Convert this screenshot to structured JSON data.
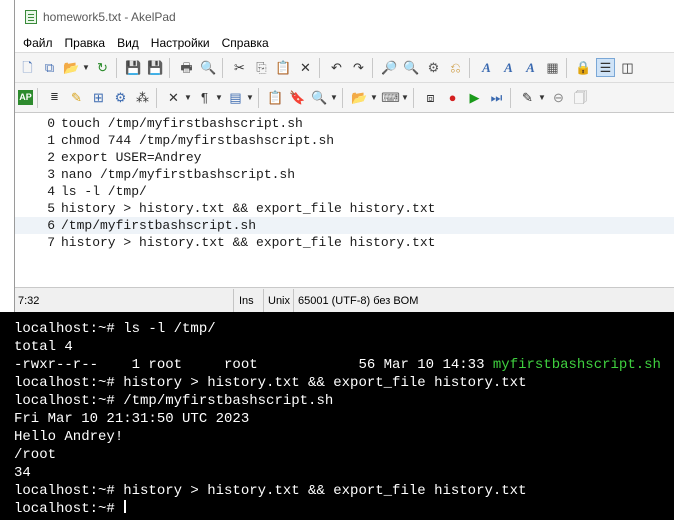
{
  "window": {
    "title": "homework5.txt - AkelPad"
  },
  "menu": [
    "Файл",
    "Правка",
    "Вид",
    "Настройки",
    "Справка"
  ],
  "toolbar1": [
    "new-file",
    "new-window",
    "open",
    "reopen",
    "save",
    "save-all",
    "print",
    "print-preview",
    "cut",
    "copy",
    "paste",
    "delete",
    "undo",
    "redo",
    "find",
    "find-next",
    "find-prev",
    "replace",
    "font",
    "font-bold",
    "font-style",
    "color-theme",
    "plugin-lock",
    "wordwrap"
  ],
  "editor": {
    "lines": [
      {
        "num": "0",
        "text": "touch /tmp/myfirstbashscript.sh"
      },
      {
        "num": "1",
        "text": "chmod 744 /tmp/myfirstbashscript.sh"
      },
      {
        "num": "2",
        "text": "export USER=Andrey"
      },
      {
        "num": "3",
        "text": "nano /tmp/myfirstbashscript.sh"
      },
      {
        "num": "4",
        "text": "ls -l /tmp/"
      },
      {
        "num": "5",
        "text": "history > history.txt && export_file history.txt"
      },
      {
        "num": "6",
        "text": "/tmp/myfirstbashscript.sh"
      },
      {
        "num": "7",
        "text": "history > history.txt && export_file history.txt"
      }
    ]
  },
  "statusbar": {
    "position": "7:32",
    "insert_mode": "Ins",
    "eol": "Unix",
    "encoding": "65001 (UTF-8) без BOM"
  },
  "terminal": {
    "lines": [
      "localhost:~# ls -l /tmp/",
      "total 4",
      "-rwxr--r--    1 root     root            56 Mar 10 14:33 ",
      "localhost:~# history > history.txt && export_file history.txt",
      "localhost:~# /tmp/myfirstbashscript.sh",
      "Fri Mar 10 21:31:50 UTC 2023",
      "Hello Andrey!",
      "/root",
      "34",
      "localhost:~# history > history.txt && export_file history.txt",
      "localhost:~# "
    ],
    "highlighted_filename": "myfirstbashscript.sh",
    "filename_color": "#3fd03f"
  }
}
